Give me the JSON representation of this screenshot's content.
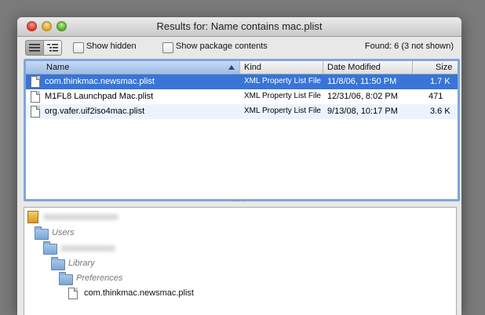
{
  "window": {
    "title": "Results for: Name contains mac.plist"
  },
  "toolbar": {
    "show_hidden_label": "Show hidden",
    "show_package_contents_label": "Show package contents",
    "found_text": "Found: 6 (3 not shown)"
  },
  "table": {
    "headers": {
      "name": "Name",
      "kind": "Kind",
      "date": "Date Modified",
      "size": "Size"
    },
    "rows": [
      {
        "name": "com.thinkmac.newsmac.plist",
        "kind": "XML Property List File",
        "date": "11/8/06, 11:50 PM",
        "size": "1.7 K",
        "selected": true
      },
      {
        "name": "M1FL8 Launchpad Mac.plist",
        "kind": "XML Property List File",
        "date": "12/31/06, 8:02 PM",
        "size": "471",
        "selected": false
      },
      {
        "name": "org.vafer.uif2iso4mac.plist",
        "kind": "XML Property List File",
        "date": "9/13/08, 10:17 PM",
        "size": "3.6 K",
        "selected": false
      }
    ]
  },
  "path": {
    "items": [
      {
        "label": "Users"
      },
      {
        "label": "Library"
      },
      {
        "label": "Preferences"
      },
      {
        "label": "com.thinkmac.newsmac.plist"
      }
    ]
  },
  "colors": {
    "selection": "#3875d7",
    "focus_ring": "#7ea7dd",
    "folder": "#7aa5d6"
  }
}
